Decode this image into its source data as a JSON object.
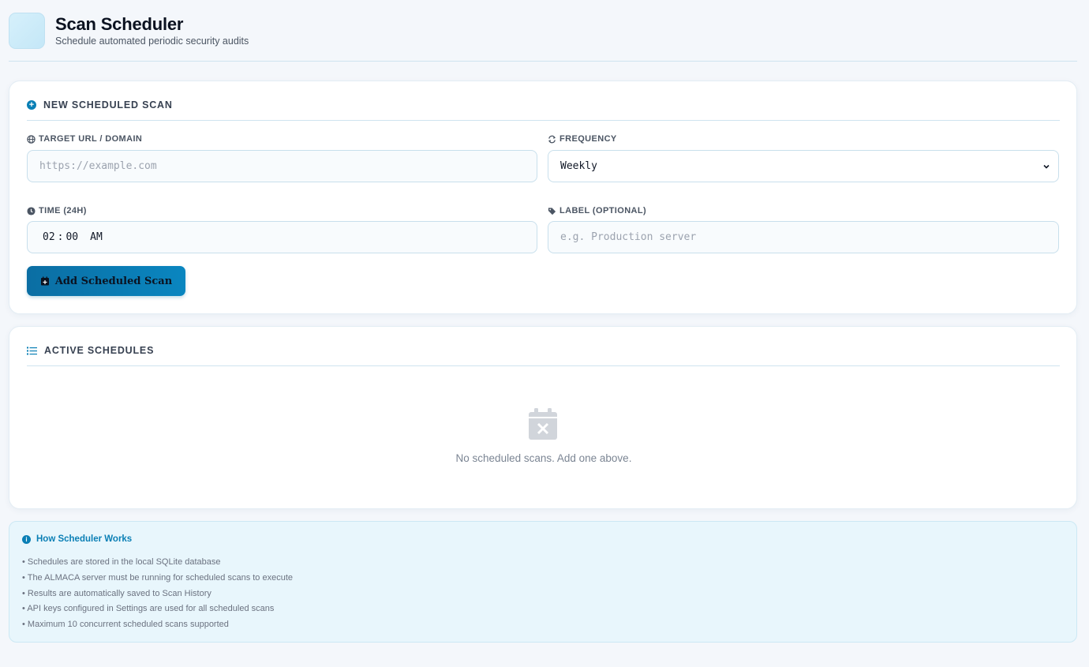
{
  "header": {
    "title": "Scan Scheduler",
    "subtitle": "Schedule automated periodic security audits"
  },
  "new_scan": {
    "section_title": "NEW SCHEDULED SCAN",
    "target": {
      "label": "TARGET URL / DOMAIN",
      "placeholder": "https://example.com",
      "value": ""
    },
    "frequency": {
      "label": "FREQUENCY",
      "value": "Weekly"
    },
    "time": {
      "label": "TIME (24H)",
      "hour": "02",
      "separator": ":",
      "minute": "00",
      "ampm": "AM"
    },
    "tag": {
      "label": "LABEL (OPTIONAL)",
      "placeholder": "e.g. Production server",
      "value": ""
    },
    "submit_label": "Add Scheduled Scan"
  },
  "active": {
    "section_title": "ACTIVE SCHEDULES",
    "empty_message": "No scheduled scans. Add one above."
  },
  "info": {
    "title": "How Scheduler Works",
    "items": [
      "Schedules are stored in the local SQLite database",
      "The ALMACA server must be running for scheduled scans to execute",
      "Results are automatically saved to Scan History",
      "API keys configured in Settings are used for all scheduled scans",
      "Maximum 10 concurrent scheduled scans supported"
    ]
  },
  "icons": {
    "plus_circle": "plus-circle-icon",
    "globe": "globe-icon",
    "repeat": "repeat-icon",
    "clock": "clock-icon",
    "tag": "tag-icon",
    "calendar_plus": "calendar-plus-icon",
    "list": "list-icon",
    "calendar_x": "calendar-x-icon",
    "info": "info-icon"
  },
  "colors": {
    "accent": "#0a7fb5",
    "button_start": "#0b6ea3",
    "button_end": "#0a86c0",
    "info_bg": "#e8f6fc"
  }
}
